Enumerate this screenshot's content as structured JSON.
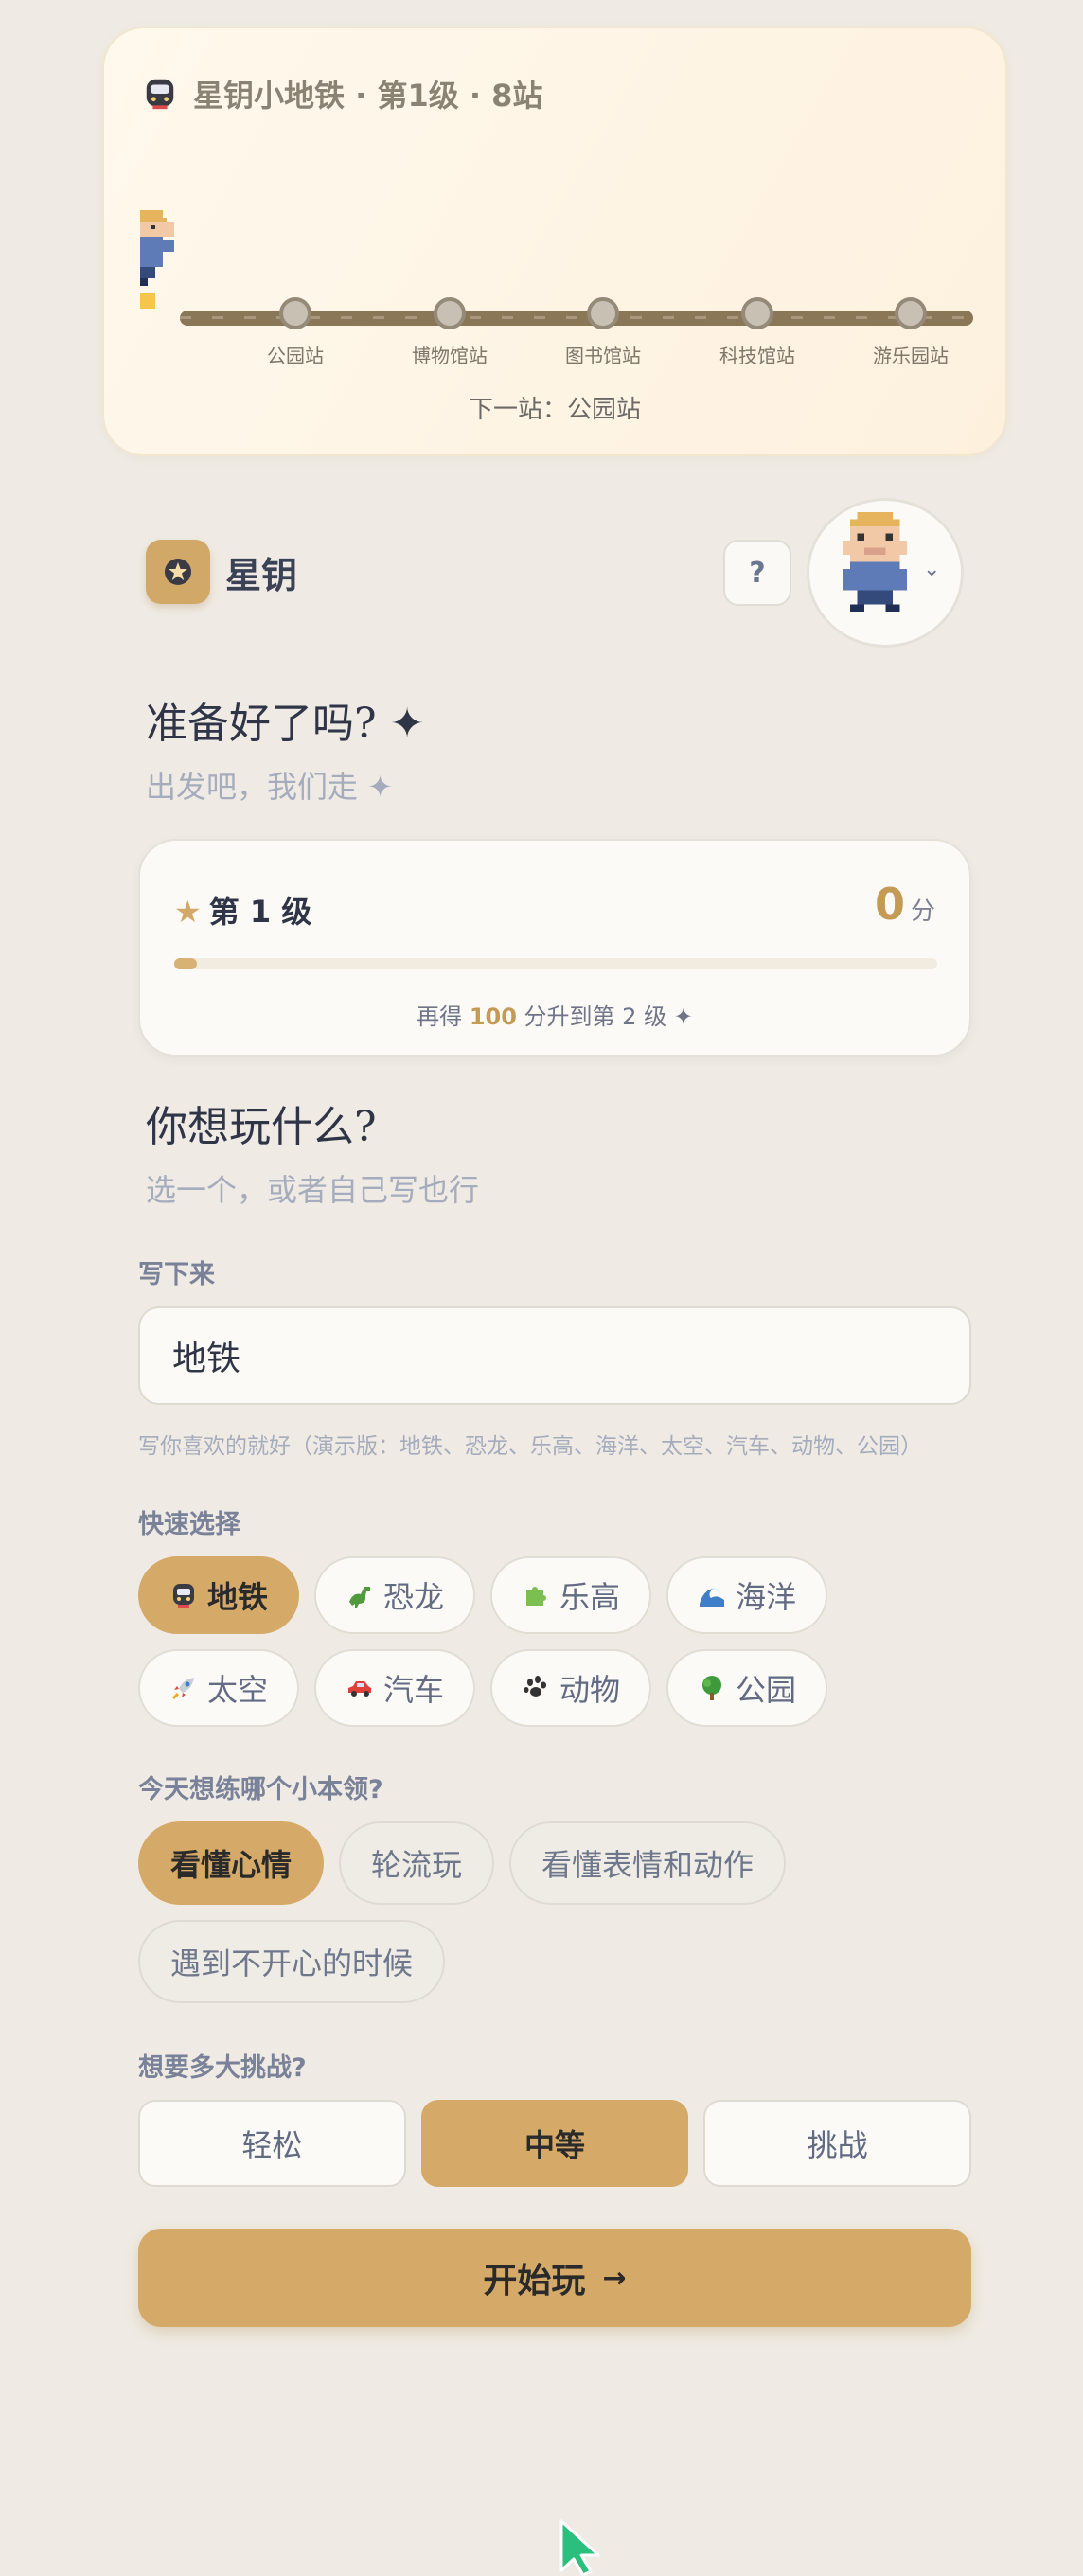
{
  "metro": {
    "title": "星钥小地铁 · 第1级 · 8站",
    "stations": [
      "公园站",
      "博物馆站",
      "图书馆站",
      "科技馆站",
      "游乐园站"
    ],
    "next_station": "下一站：公园站"
  },
  "brand": {
    "name": "星钥",
    "help_label": "?"
  },
  "ready": {
    "title": "准备好了吗? ✦",
    "subtitle": "出发吧，我们走 ✦"
  },
  "level": {
    "label": "第 1 级",
    "score": "0",
    "score_unit": "分",
    "progress": 0.03,
    "hint_prefix": "再得 ",
    "hint_points": "100",
    "hint_suffix": " 分升到第 2 级 ✦"
  },
  "play": {
    "title": "你想玩什么?",
    "subtitle": "选一个，或者自己写也行",
    "write_label": "写下来",
    "input_value": "地铁",
    "input_hint": "写你喜欢的就好（演示版：地铁、恐龙、乐高、海洋、太空、汽车、动物、公园）"
  },
  "quick": {
    "label": "快速选择",
    "chips": [
      {
        "label": "地铁",
        "icon": "metro-icon",
        "active": true
      },
      {
        "label": "恐龙",
        "icon": "dinosaur-icon",
        "active": false
      },
      {
        "label": "乐高",
        "icon": "puzzle-icon",
        "active": false
      },
      {
        "label": "海洋",
        "icon": "wave-icon",
        "active": false
      },
      {
        "label": "太空",
        "icon": "rocket-icon",
        "active": false
      },
      {
        "label": "汽车",
        "icon": "car-icon",
        "active": false
      },
      {
        "label": "动物",
        "icon": "paw-icon",
        "active": false
      },
      {
        "label": "公园",
        "icon": "tree-icon",
        "active": false
      }
    ]
  },
  "skills": {
    "label": "今天想练哪个小本领?",
    "items": [
      "看懂心情",
      "轮流玩",
      "看懂表情和动作",
      "遇到不开心的时候"
    ],
    "selected": "看懂心情"
  },
  "difficulty": {
    "label": "想要多大挑战?",
    "options": [
      "轻松",
      "中等",
      "挑战"
    ],
    "selected": "中等"
  },
  "start": {
    "label": "开始玩",
    "arrow": "→"
  },
  "colors": {
    "accent": "#d5aa68",
    "background": "#efebe4",
    "text": "#3b4256"
  }
}
